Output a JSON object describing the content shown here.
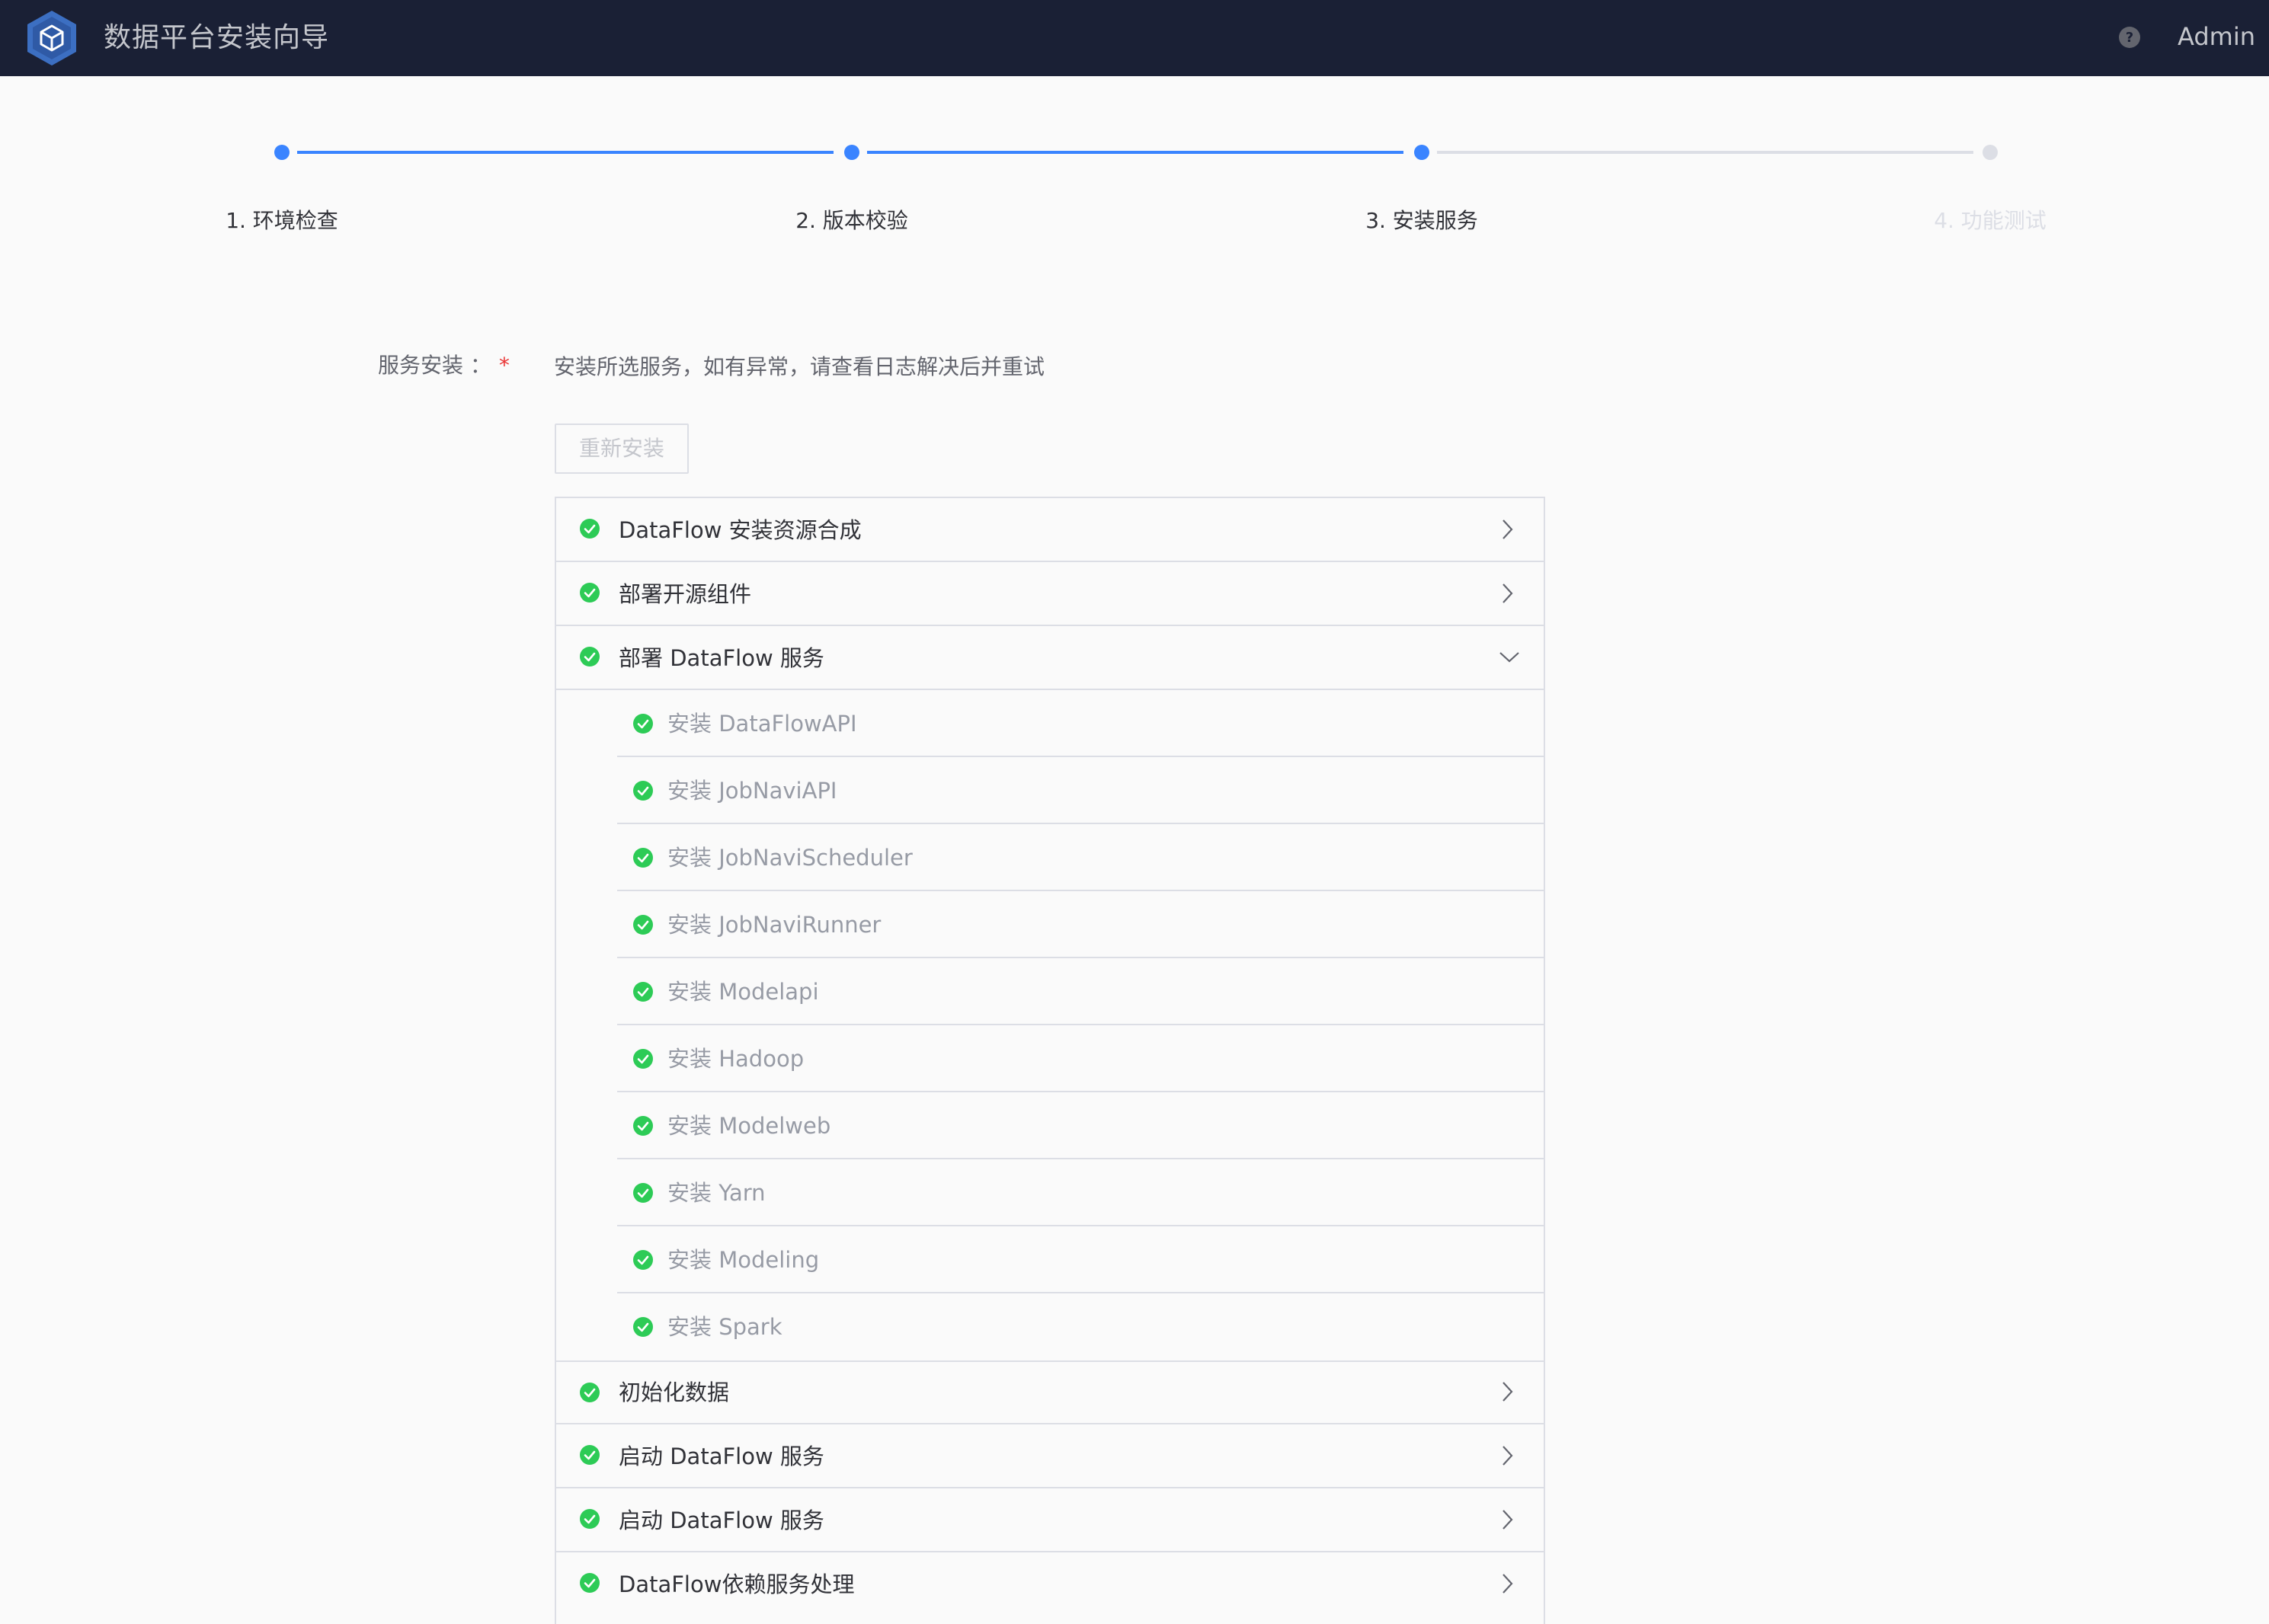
{
  "header": {
    "title": "数据平台安装向导",
    "user": "Admin",
    "help_icon": "help-icon",
    "logo_icon": "cube-logo-icon"
  },
  "steps": [
    {
      "label": "1. 环境检查",
      "state": "done"
    },
    {
      "label": "2. 版本校验",
      "state": "done"
    },
    {
      "label": "3. 安装服务",
      "state": "active"
    },
    {
      "label": "4. 功能测试",
      "state": "pending"
    }
  ],
  "form": {
    "label": "服务安装 ：",
    "required_mark": "*",
    "description": "安装所选服务，如有异常，请查看日志解决后并重试",
    "reinstall_label": "重新安装"
  },
  "tasks": {
    "items": [
      {
        "label": "DataFlow 安装资源合成",
        "expanded": false
      },
      {
        "label": "部署开源组件",
        "expanded": false
      },
      {
        "label": "部署 DataFlow 服务",
        "expanded": true
      },
      {
        "label": "初始化数据",
        "expanded": false
      },
      {
        "label": "启动 DataFlow 服务",
        "expanded": false
      },
      {
        "label": "启动 DataFlow 服务",
        "expanded": false
      },
      {
        "label": "DataFlow依赖服务处理",
        "expanded": false
      }
    ],
    "subitems": [
      "安装 DataFlowAPI",
      "安装 JobNaviAPI",
      "安装 JobNaviScheduler",
      "安装 JobNaviRunner",
      "安装 Modelapi",
      "安装 Hadoop",
      "安装 Modelweb",
      "安装 Yarn",
      "安装 Modeling",
      "安装 Spark"
    ]
  },
  "colors": {
    "header_bg": "#1a2035",
    "accent": "#3a84ff",
    "success": "#2dcb56",
    "border": "#dcdee5"
  }
}
